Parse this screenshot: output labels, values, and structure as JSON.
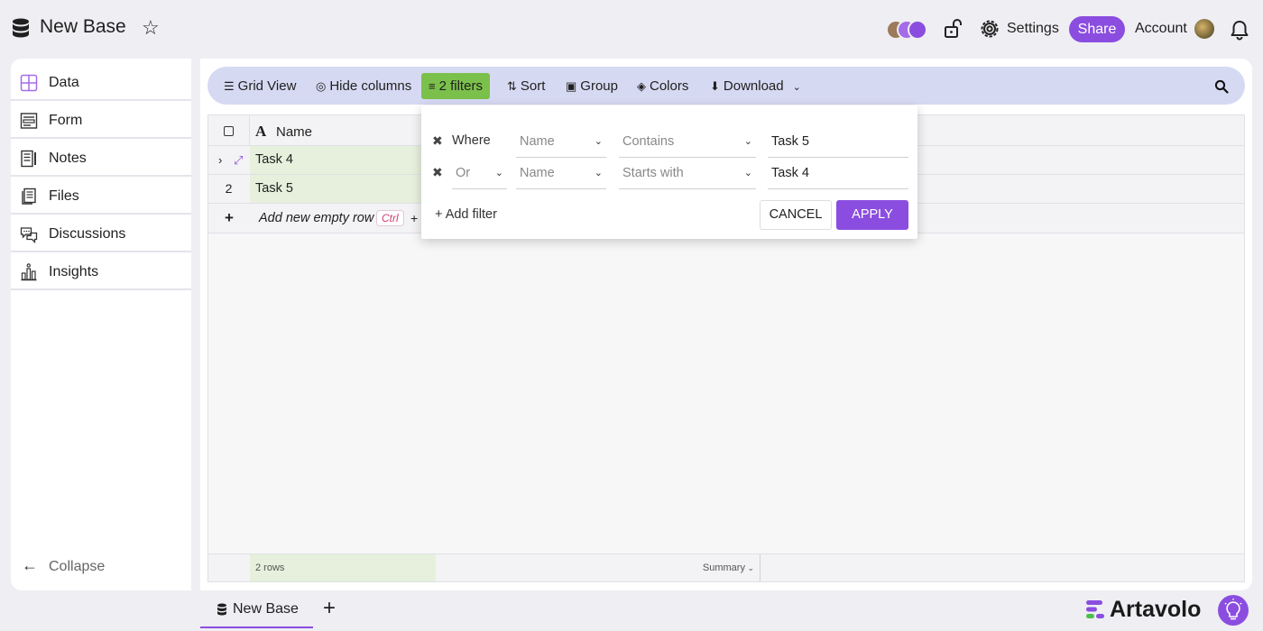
{
  "app": {
    "title": "New Base",
    "settings_label": "Settings",
    "share_label": "Share",
    "account_label": "Account"
  },
  "sidebar": {
    "items": [
      {
        "label": "Data",
        "icon": "grid-icon"
      },
      {
        "label": "Form",
        "icon": "form-icon"
      },
      {
        "label": "Notes",
        "icon": "notes-icon"
      },
      {
        "label": "Files",
        "icon": "files-icon"
      },
      {
        "label": "Discussions",
        "icon": "discussions-icon"
      },
      {
        "label": "Insights",
        "icon": "insights-icon"
      }
    ],
    "collapse_label": "Collapse"
  },
  "toolbar": {
    "grid_view": "Grid View",
    "hide_columns": "Hide columns",
    "filters": "2 filters",
    "sort": "Sort",
    "group": "Group",
    "colors": "Colors",
    "download": "Download"
  },
  "grid": {
    "column_name": "Name",
    "rows": [
      {
        "index": "",
        "name": "Task 4"
      },
      {
        "index": "2",
        "name": "Task 5"
      }
    ],
    "add_row_label": "Add new empty row",
    "shortcut_key": "Ctrl",
    "shortcut_plus": "+",
    "row_count": "2 rows",
    "summary_label": "Summary"
  },
  "filter_popup": {
    "rows": [
      {
        "conjunction": "Where",
        "field": "Name",
        "operator": "Contains",
        "value": "Task 5"
      },
      {
        "conjunction": "Or",
        "field": "Name",
        "operator": "Starts with",
        "value": "Task 4"
      }
    ],
    "add_filter_label": "+ Add filter",
    "cancel_label": "CANCEL",
    "apply_label": "APPLY"
  },
  "tabs": {
    "base_tab": "New Base"
  },
  "brand": {
    "name": "Artavolo"
  },
  "colors": {
    "accent": "#8b4ddf",
    "filter_active": "#7bc04b",
    "toolbar_bg": "#d6d9f2",
    "name_column_bg": "#e6f0dc"
  }
}
